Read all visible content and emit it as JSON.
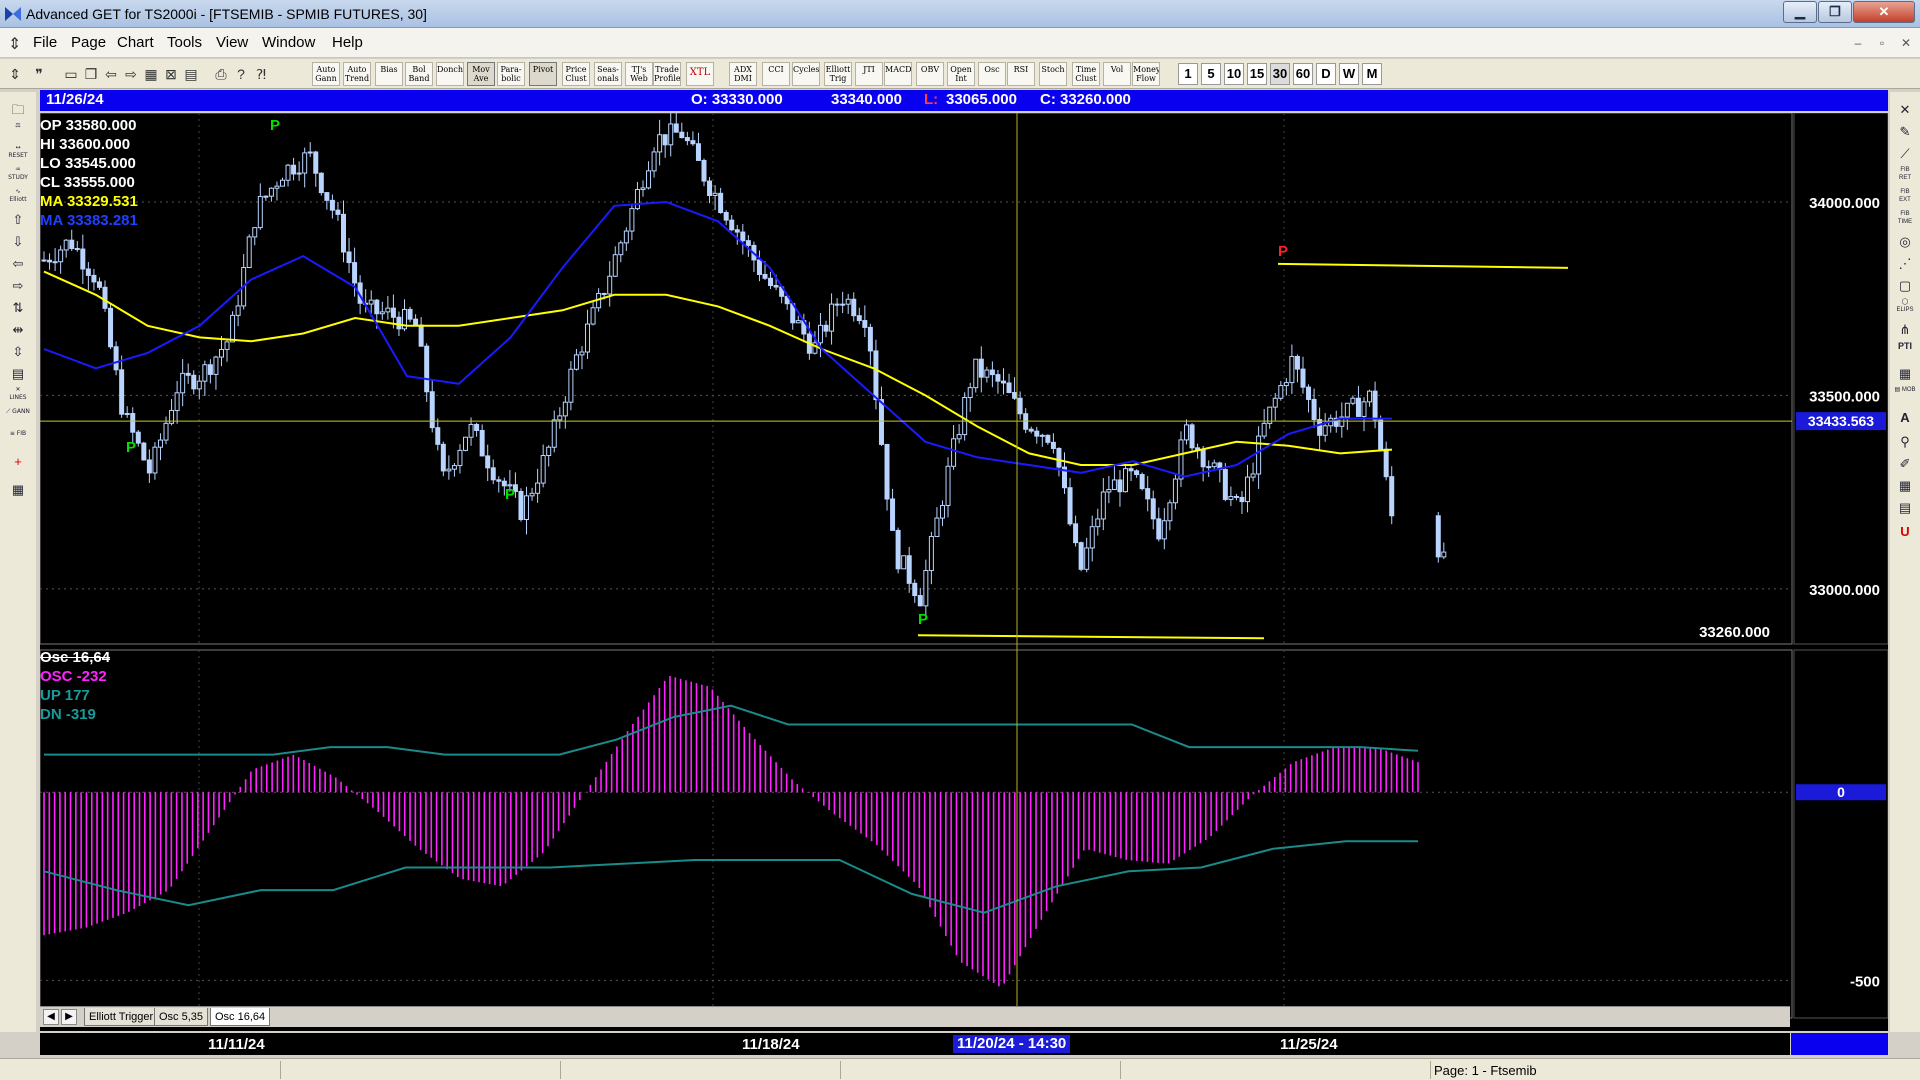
{
  "window": {
    "title": "Advanced GET for TS2000i - [FTSEMIB - SPMIB FUTURES, 30]",
    "buttons": {
      "minimize": "▁",
      "maximize": "❐",
      "close": "✕"
    }
  },
  "menu": {
    "items": [
      "File",
      "Page",
      "Chart",
      "Tools",
      "View",
      "Window",
      "Help"
    ],
    "mdi_buttons": {
      "minimize": "–",
      "restore": "▫",
      "close": "✕"
    }
  },
  "toolbar": {
    "study_buttons": [
      "Auto Gann",
      "Auto Trend",
      "Bias",
      "Bol Band",
      "Donch",
      "Mov Ave",
      "Para-bolic",
      "Pivot",
      "Price Clust",
      "Seas-onals",
      "TJ's Web",
      "Trade Profile",
      "XTL",
      "ADX DMI",
      "CCI",
      "Cycles",
      "Elliott Trig",
      "JTI",
      "MACD",
      "OBV",
      "Open Int",
      "Osc",
      "RSI",
      "Stoch",
      "Time Clust",
      "Vol",
      "Money Flow"
    ],
    "timeframes": [
      "1",
      "5",
      "10",
      "15",
      "30",
      "60",
      "D",
      "W",
      "M"
    ],
    "active_timeframe": "30"
  },
  "infobar": {
    "date": "11/26/24",
    "open": "O: 33330.000",
    "high": "33340.000",
    "low_prefix": "L:",
    "low": "33065.000",
    "close": "C: 33260.000"
  },
  "readout": {
    "op": "OP  33580.000",
    "hi": "HI    33600.000",
    "lo": "LO   33545.000",
    "cl": "CL   33555.000",
    "ma1": "MA  33329.531",
    "ma2": "MA  33383.281"
  },
  "price_axis": {
    "labels": [
      "34000.000",
      "33500.000",
      "33000.000"
    ],
    "cursor_price": "33433.563",
    "last_price": "33260.000"
  },
  "pivots": [
    "P",
    "P",
    "P",
    "P",
    "P",
    "P"
  ],
  "oscillator": {
    "title": "Osc 16,64",
    "osc": "OSC -232",
    "up": "UP    177",
    "dn": "DN   -319",
    "axis_zero": "0",
    "axis_low": "-500"
  },
  "tabs": {
    "items": [
      "Elliott Trigger",
      "Osc 5,35",
      "Osc 16,64"
    ],
    "active": 2,
    "left_arrow": "◀",
    "right_arrow": "▶"
  },
  "date_axis": {
    "labels": [
      "11/11/24",
      "11/18/24",
      "11/25/24"
    ],
    "cursor_date": "11/20/24 - 14:30"
  },
  "status": {
    "page": "Page: 1 - Ftsemib"
  },
  "colors": {
    "candle": "#b8d4ff",
    "ma_yellow": "#ffff00",
    "ma_blue": "#1a1aff",
    "osc_magenta": "#ff22ff",
    "band_teal": "#1a8a8a",
    "pivot_green": "#00e000",
    "pivot_red": "#ff2020",
    "info_blue": "#0a00f0"
  },
  "chart_data": {
    "type": "candlestick",
    "instrument": "FTSEMIB - SPMIB FUTURES",
    "interval": "30",
    "y_axis": {
      "ticks": [
        34000,
        33500,
        33000
      ],
      "range": [
        32860,
        34230
      ]
    },
    "price_series": [
      33850,
      33900,
      33800,
      33450,
      33300,
      33520,
      33560,
      33650,
      33980,
      34080,
      34120,
      33960,
      33720,
      33710,
      33680,
      33280,
      33420,
      33300,
      33200,
      33360,
      33590,
      33760,
      33950,
      34160,
      34180,
      34050,
      33940,
      33820,
      33720,
      33620,
      33760,
      33700,
      33100,
      32980,
      33290,
      33570,
      33530,
      33430,
      33390,
      33040,
      33260,
      33290,
      33150,
      33410,
      33310,
      33200,
      33430,
      33590,
      33420,
      33450,
      33500,
      33080,
      33260
    ],
    "yellow_ma": [
      33820,
      33760,
      33680,
      33650,
      33640,
      33660,
      33700,
      33680,
      33680,
      33700,
      33720,
      33760,
      33760,
      33730,
      33680,
      33620,
      33570,
      33500,
      33420,
      33350,
      33320,
      33320,
      33350,
      33380,
      33370,
      33350,
      33360
    ],
    "blue_ma": [
      33620,
      33570,
      33610,
      33680,
      33800,
      33860,
      33780,
      33550,
      33530,
      33650,
      33830,
      33990,
      34000,
      33950,
      33830,
      33620,
      33500,
      33380,
      33340,
      33320,
      33300,
      33330,
      33290,
      33320,
      33400,
      33440,
      33440
    ],
    "osc_values": [
      -380,
      -360,
      -320,
      -260,
      -100,
      60,
      100,
      40,
      -50,
      -150,
      -230,
      -250,
      -160,
      0,
      160,
      310,
      280,
      150,
      30,
      -60,
      -140,
      -250,
      -450,
      -520,
      -330,
      -150,
      -180,
      -190,
      -120,
      -10,
      80,
      120,
      120,
      80
    ],
    "upper_band": [
      100,
      100,
      100,
      100,
      100,
      120,
      120,
      100,
      100,
      100,
      140,
      200,
      230,
      180,
      180,
      180,
      180,
      180,
      180,
      180,
      120,
      120,
      120,
      120,
      110
    ],
    "lower_band": [
      -210,
      -260,
      -300,
      -260,
      -260,
      -200,
      -200,
      -200,
      -190,
      -180,
      -180,
      -180,
      -270,
      -320,
      -250,
      -210,
      -200,
      -150,
      -130,
      -130
    ],
    "horizontal_lines": [
      {
        "price": 33433.563,
        "color": "#c8c820"
      },
      {
        "price": 33840,
        "color": "#ffff00"
      },
      {
        "price": 32880,
        "color": "#ffff00"
      }
    ],
    "osc_axis": {
      "ticks": [
        0,
        -500
      ]
    }
  }
}
